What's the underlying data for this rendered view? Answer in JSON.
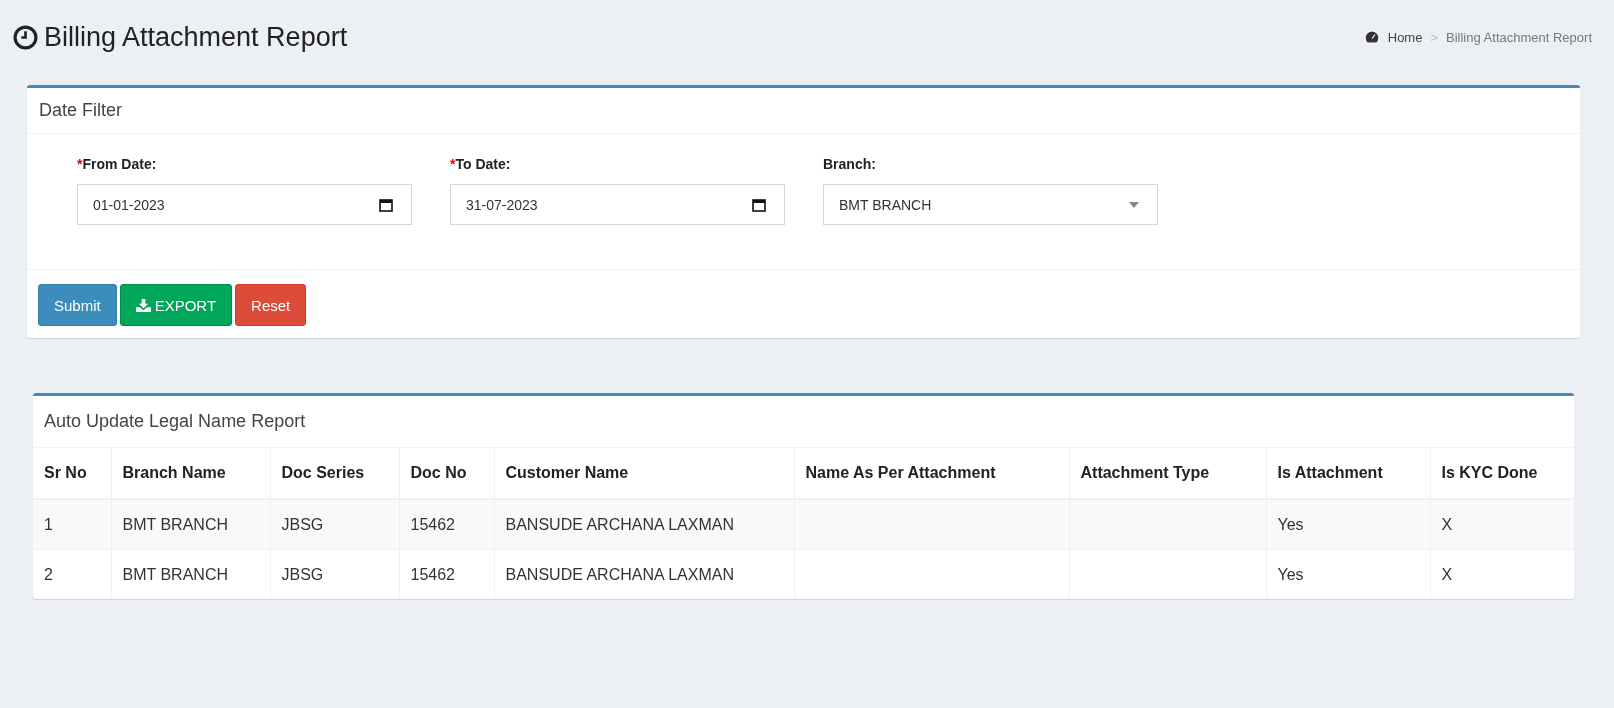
{
  "page": {
    "title": "Billing Attachment Report"
  },
  "breadcrumb": [
    {
      "label": "Home",
      "kind": "home"
    },
    {
      "separator": ">",
      "label": "Billing Attachment Report",
      "kind": "current"
    }
  ],
  "filter_panel": {
    "title": "Date Filter",
    "fields": [
      {
        "required_mark": "*",
        "label": "From Date:",
        "kind": "date",
        "value": "01-01-2023"
      },
      {
        "required_mark": "*",
        "label": "To Date:",
        "kind": "date",
        "value": "31-07-2023"
      },
      {
        "label": "Branch:",
        "kind": "select",
        "value": "BMT BRANCH"
      }
    ],
    "buttons": [
      {
        "label": "Submit",
        "kind": "submit"
      },
      {
        "label": "EXPORT",
        "kind": "export"
      },
      {
        "label": "Reset",
        "kind": "reset"
      }
    ]
  },
  "report": {
    "title": "Auto Update Legal Name Report",
    "columns": [
      "Sr No",
      "Branch Name",
      "Doc Series",
      "Doc No",
      "Customer Name",
      "Name As Per Attachment",
      "Attachment Type",
      "Is Attachment",
      "Is KYC Done"
    ],
    "rows": [
      [
        "1",
        "BMT BRANCH",
        "JBSG",
        "15462",
        "BANSUDE ARCHANA LAXMAN",
        "",
        "",
        "Yes",
        "X"
      ],
      [
        "2",
        "BMT BRANCH",
        "JBSG",
        "15462",
        "BANSUDE ARCHANA LAXMAN",
        "",
        "",
        "Yes",
        "X"
      ]
    ]
  }
}
